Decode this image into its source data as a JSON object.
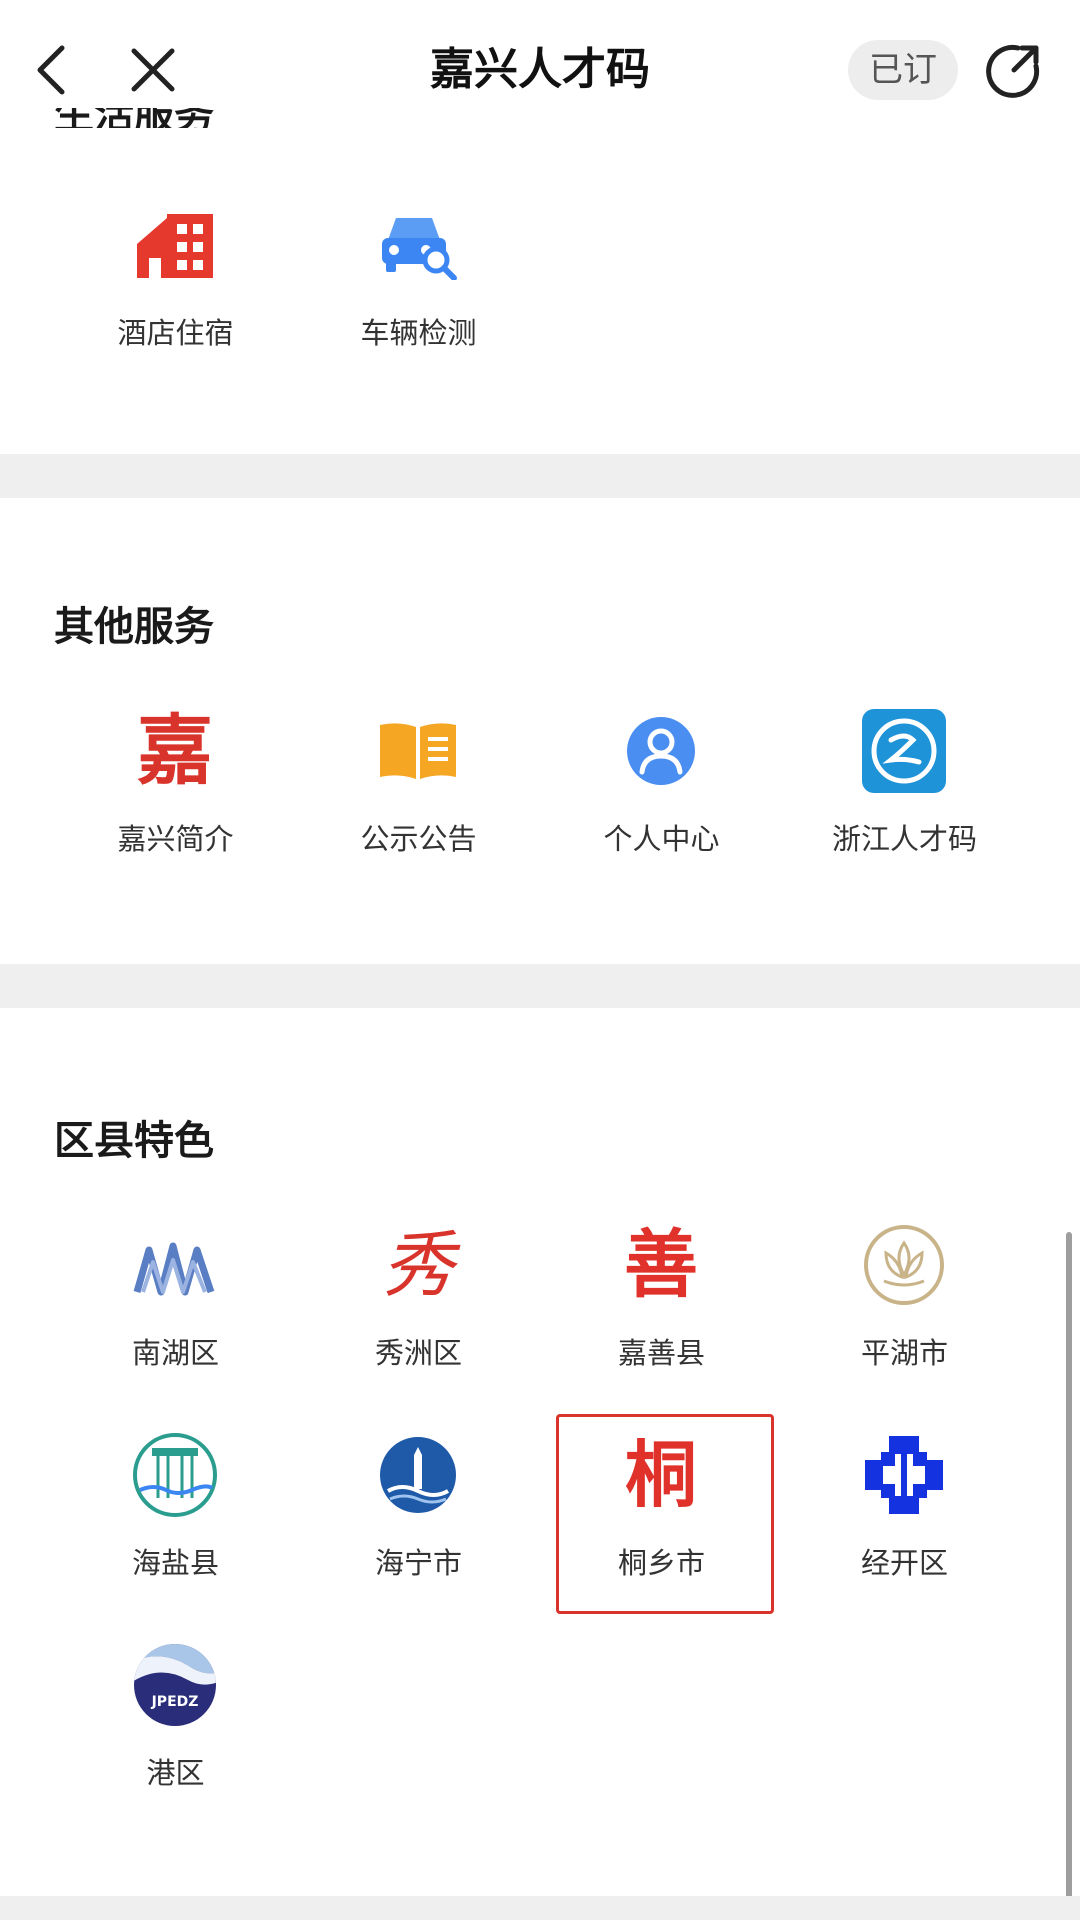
{
  "header": {
    "title": "嘉兴人才码",
    "subscribed_label": "已订"
  },
  "prev_section": {
    "title": "生活服务",
    "items": [
      {
        "label": "酒店住宿",
        "icon": "hotel-icon"
      },
      {
        "label": "车辆检测",
        "icon": "car-inspection-icon"
      }
    ]
  },
  "other_services": {
    "title": "其他服务",
    "items": [
      {
        "label": "嘉兴简介",
        "icon": "jiaxing-logo-icon"
      },
      {
        "label": "公示公告",
        "icon": "book-icon"
      },
      {
        "label": "个人中心",
        "icon": "user-icon"
      },
      {
        "label": "浙江人才码",
        "icon": "zhejiang-talent-icon"
      }
    ]
  },
  "district_features": {
    "title": "区县特色",
    "items": [
      {
        "label": "南湖区",
        "icon": "nanhu-logo-icon"
      },
      {
        "label": "秀洲区",
        "icon": "xiuzhou-logo-icon"
      },
      {
        "label": "嘉善县",
        "icon": "jiashan-logo-icon"
      },
      {
        "label": "平湖市",
        "icon": "pinghu-logo-icon"
      },
      {
        "label": "海盐县",
        "icon": "haiyan-logo-icon"
      },
      {
        "label": "海宁市",
        "icon": "haining-logo-icon"
      },
      {
        "label": "桐乡市",
        "icon": "tongxiang-logo-icon"
      },
      {
        "label": "经开区",
        "icon": "jingkai-logo-icon"
      },
      {
        "label": "港区",
        "icon": "port-zone-logo-icon"
      }
    ]
  },
  "logos": {
    "jia": "嘉",
    "xiu": "秀",
    "shan": "善",
    "tong": "桐",
    "jpedz": "JPEDZ"
  },
  "colors": {
    "accent_red": "#e0312b",
    "divider": "#efefef",
    "highlight_border": "#d9342b",
    "blue": "#3b86f2"
  }
}
